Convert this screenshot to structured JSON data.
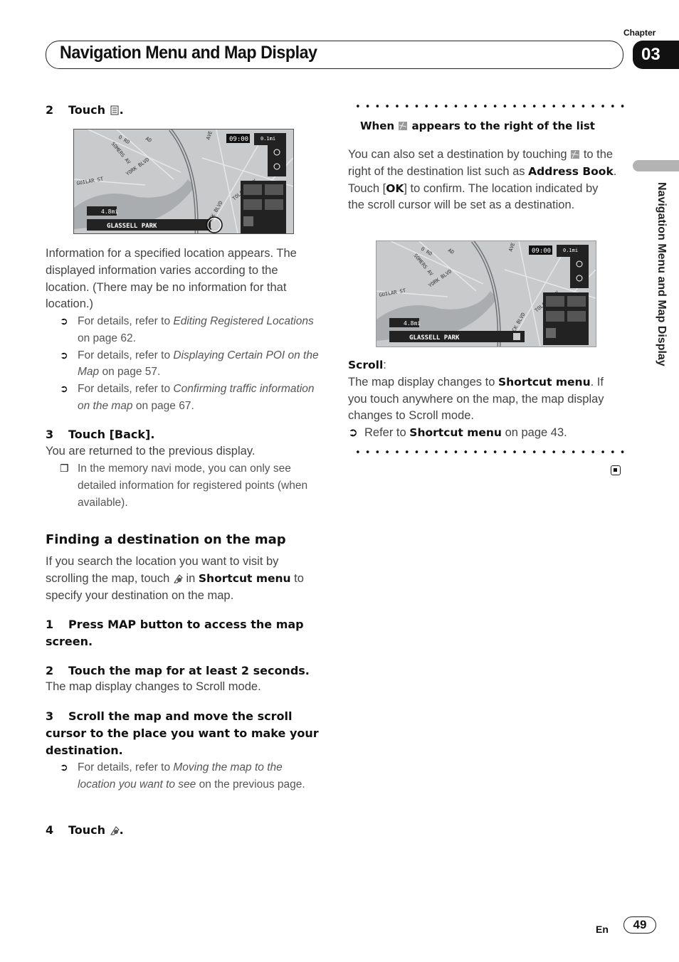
{
  "header": {
    "chapter_label": "Chapter",
    "chapter_number": "03",
    "title": "Navigation Menu and Map Display"
  },
  "side_tab": {
    "label": "Navigation Menu and Map Display"
  },
  "left_column": {
    "step2_number": "2",
    "step2_text": "Touch",
    "step2_icon": "list-icon",
    "map1": {
      "clock": "09:00",
      "scale": "0.1mi",
      "distance": "4.8mi",
      "place": "GLASSELL PARK",
      "streets": [
        "O RD",
        "AD",
        "SOMERS AV",
        "YORK BLVD",
        "GUILAR ST",
        "AVE",
        "TOLAND WAY",
        "EAGLE ROCK BLVD"
      ]
    },
    "info_paragraph": "Information for a specified location appears. The displayed information varies according to the location. (There may be no information for that location.)",
    "refs": [
      {
        "pre": "For details, refer to ",
        "italic": "Editing Registered Locations",
        "post": " on page 62."
      },
      {
        "pre": "For details, refer to ",
        "italic": "Displaying Certain POI on the Map",
        "post": " on page 57."
      },
      {
        "pre": "For details, refer to ",
        "italic": "Confirming traffic information on the map",
        "post": " on page 67."
      }
    ],
    "step3_number": "3",
    "step3_text": "Touch [Back].",
    "step3_desc": "You are returned to the previous display.",
    "note": "In the memory navi mode, you can only see detailed information for registered points (when available).",
    "section_heading": "Finding a destination on the map",
    "section_intro_1": "If you search the location you want to visit by scrolling the map, touch",
    "section_intro_2": "in",
    "section_intro_bold": "Shortcut menu",
    "section_intro_3": "to specify your destination on the map.",
    "steps": [
      {
        "n": "1",
        "text": "Press MAP button to access the map screen."
      },
      {
        "n": "2",
        "text": "Touch the map for at least 2 seconds.",
        "desc": "The map display changes to Scroll mode."
      },
      {
        "n": "3",
        "text": "Scroll the map and move the scroll cursor to the place you want to make your destination.",
        "ref_pre": "For details, refer to ",
        "ref_italic": "Moving the map to the location you want to see",
        "ref_post": " on the previous page."
      },
      {
        "n": "4",
        "text": "Touch",
        "icon": "destination-flag-icon"
      }
    ]
  },
  "right_column": {
    "box_heading_1": "When",
    "box_heading_2": "appears to the right of the list",
    "para_1": "You can also set a destination by touching",
    "para_2": "to the right of the destination list such as",
    "para_bold_1": "Address Book",
    "para_3": ". Touch [",
    "para_bold_ok": "OK",
    "para_4": "] to confirm. The location indicated by the scroll cursor will be set as a destination.",
    "map2": {
      "clock": "09:00",
      "scale": "0.1mi",
      "distance": "4.8mi",
      "place": "GLASSELL PARK"
    },
    "scroll_label": "Scroll",
    "scroll_colon": ":",
    "scroll_1": "The map display changes to",
    "scroll_bold": "Shortcut menu",
    "scroll_2": ". If you touch anywhere on the map, the map display changes to Scroll mode.",
    "refer_pre": "Refer to",
    "refer_bold": "Shortcut menu",
    "refer_post": "on page 43."
  },
  "footer": {
    "lang": "En",
    "page": "49"
  }
}
